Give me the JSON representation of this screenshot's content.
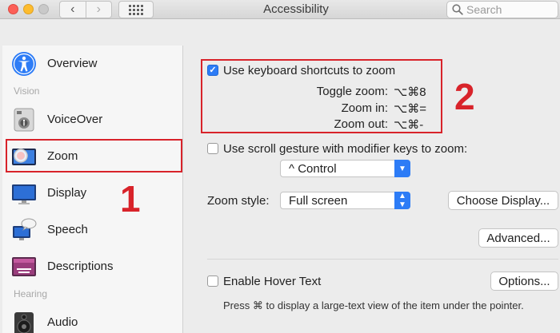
{
  "window": {
    "title": "Accessibility"
  },
  "toolbar": {
    "back": "‹",
    "forward": "›",
    "search_placeholder": "Search"
  },
  "sidebar": {
    "items": [
      {
        "label": "Overview",
        "icon": "accessibility-icon"
      },
      {
        "label": "VoiceOver",
        "icon": "voiceover-icon"
      },
      {
        "label": "Zoom",
        "icon": "zoom-icon",
        "selected": true
      },
      {
        "label": "Display",
        "icon": "display-icon"
      },
      {
        "label": "Speech",
        "icon": "speech-icon"
      },
      {
        "label": "Descriptions",
        "icon": "descriptions-icon"
      },
      {
        "label": "Audio",
        "icon": "speaker-icon"
      }
    ],
    "headers": {
      "vision": "Vision",
      "hearing": "Hearing"
    }
  },
  "annotations": {
    "one": "1",
    "two": "2"
  },
  "main": {
    "keyboard_shortcuts": {
      "label": "Use keyboard shortcuts to zoom",
      "checked": true
    },
    "shortcuts": [
      {
        "label": "Toggle zoom:",
        "keys": "⌥⌘8"
      },
      {
        "label": "Zoom in:",
        "keys": "⌥⌘="
      },
      {
        "label": "Zoom out:",
        "keys": "⌥⌘-"
      }
    ],
    "scroll_gesture": {
      "label": "Use scroll gesture with modifier keys to zoom:",
      "checked": false
    },
    "modifier_select": {
      "value": "^ Control"
    },
    "zoom_style": {
      "label": "Zoom style:",
      "value": "Full screen"
    },
    "choose_display_label": "Choose Display...",
    "advanced_label": "Advanced...",
    "hover_text": {
      "label": "Enable Hover Text",
      "checked": false
    },
    "options_label": "Options...",
    "hover_note": "Press ⌘ to display a large-text view of the item under the pointer."
  },
  "colors": {
    "accent": "#2d7cf6",
    "annotation_red": "#d8232a"
  }
}
